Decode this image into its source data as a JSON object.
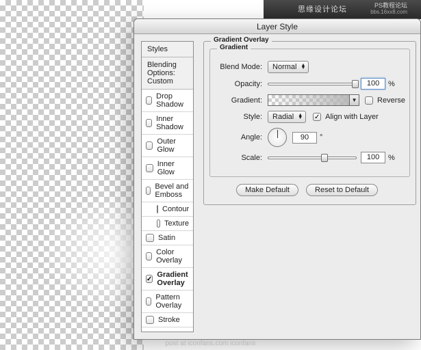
{
  "topbar": {
    "forum_label": "思缘设计论坛",
    "wm1": "PS教程论坛",
    "wm2": "bbs.16xx8.com"
  },
  "dialog": {
    "title": "Layer Style"
  },
  "sidebar": {
    "styles_label": "Styles",
    "blending_label": "Blending Options: Custom",
    "items": [
      {
        "label": "Drop Shadow",
        "checked": false
      },
      {
        "label": "Inner Shadow",
        "checked": false
      },
      {
        "label": "Outer Glow",
        "checked": false
      },
      {
        "label": "Inner Glow",
        "checked": false
      },
      {
        "label": "Bevel and Emboss",
        "checked": false
      },
      {
        "label": "Contour",
        "checked": false,
        "sub": true
      },
      {
        "label": "Texture",
        "checked": false,
        "sub": true
      },
      {
        "label": "Satin",
        "checked": false
      },
      {
        "label": "Color Overlay",
        "checked": false
      },
      {
        "label": "Gradient Overlay",
        "checked": true,
        "selected": true
      },
      {
        "label": "Pattern Overlay",
        "checked": false
      },
      {
        "label": "Stroke",
        "checked": false
      }
    ]
  },
  "overlay": {
    "section_title": "Gradient Overlay",
    "subsection_title": "Gradient",
    "blend_mode_label": "Blend Mode:",
    "blend_mode_value": "Normal",
    "opacity_label": "Opacity:",
    "opacity_value": "100",
    "gradient_label": "Gradient:",
    "reverse_label": "Reverse",
    "reverse_checked": false,
    "style_label": "Style:",
    "style_value": "Radial",
    "align_label": "Align with Layer",
    "align_checked": true,
    "angle_label": "Angle:",
    "angle_value": "90",
    "scale_label": "Scale:",
    "scale_value": "100",
    "make_default": "Make Default",
    "reset_default": "Reset to Default"
  },
  "footer": {
    "text": "post at iconfans.com  iconfans"
  }
}
